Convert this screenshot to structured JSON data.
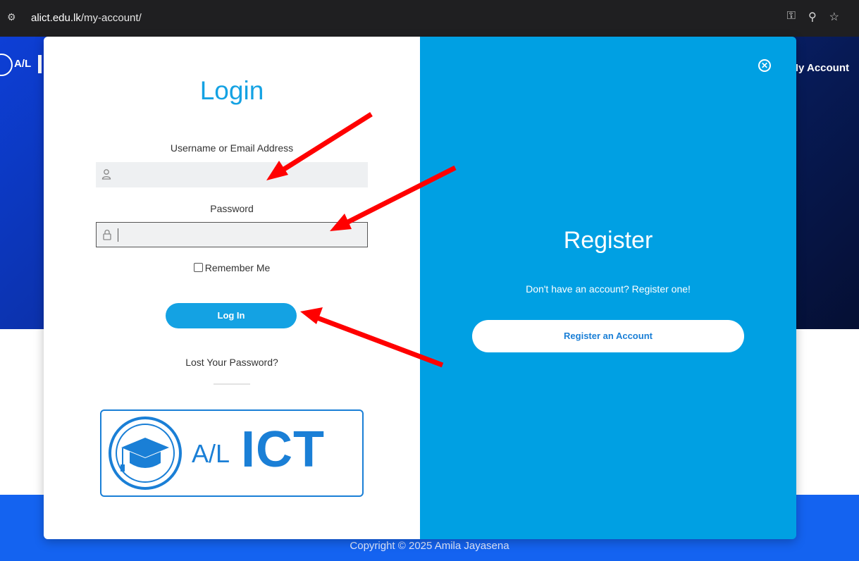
{
  "browser": {
    "url_domain": "alict.edu.lk",
    "url_path": "/my-account/",
    "icons": [
      "tune-icon",
      "key-icon",
      "zoom-icon",
      "star-icon"
    ]
  },
  "site": {
    "logo_text": "A/L",
    "nav_account": "My Account",
    "footer_copyright": "Copyright © 2025 Amila Jayasena",
    "colors": {
      "header_dark": "#050f33",
      "header_blue": "#0d3fd6",
      "footer": "#1463f0"
    }
  },
  "login": {
    "title": "Login",
    "username_label": "Username or Email Address",
    "username_value": "",
    "password_label": "Password",
    "password_value": "",
    "remember_label": "Remember Me",
    "remember_checked": false,
    "login_button": "Log In",
    "lost_password": "Lost Your Password?",
    "brand_small": "A/L",
    "brand_large": "ICT",
    "accent": "#14a2e3"
  },
  "register": {
    "title": "Register",
    "subtitle": "Don't have an account? Register one!",
    "button": "Register an Account",
    "background": "#00a0e3"
  },
  "annotations": {
    "arrow_color": "#ff0000",
    "count": 3
  }
}
